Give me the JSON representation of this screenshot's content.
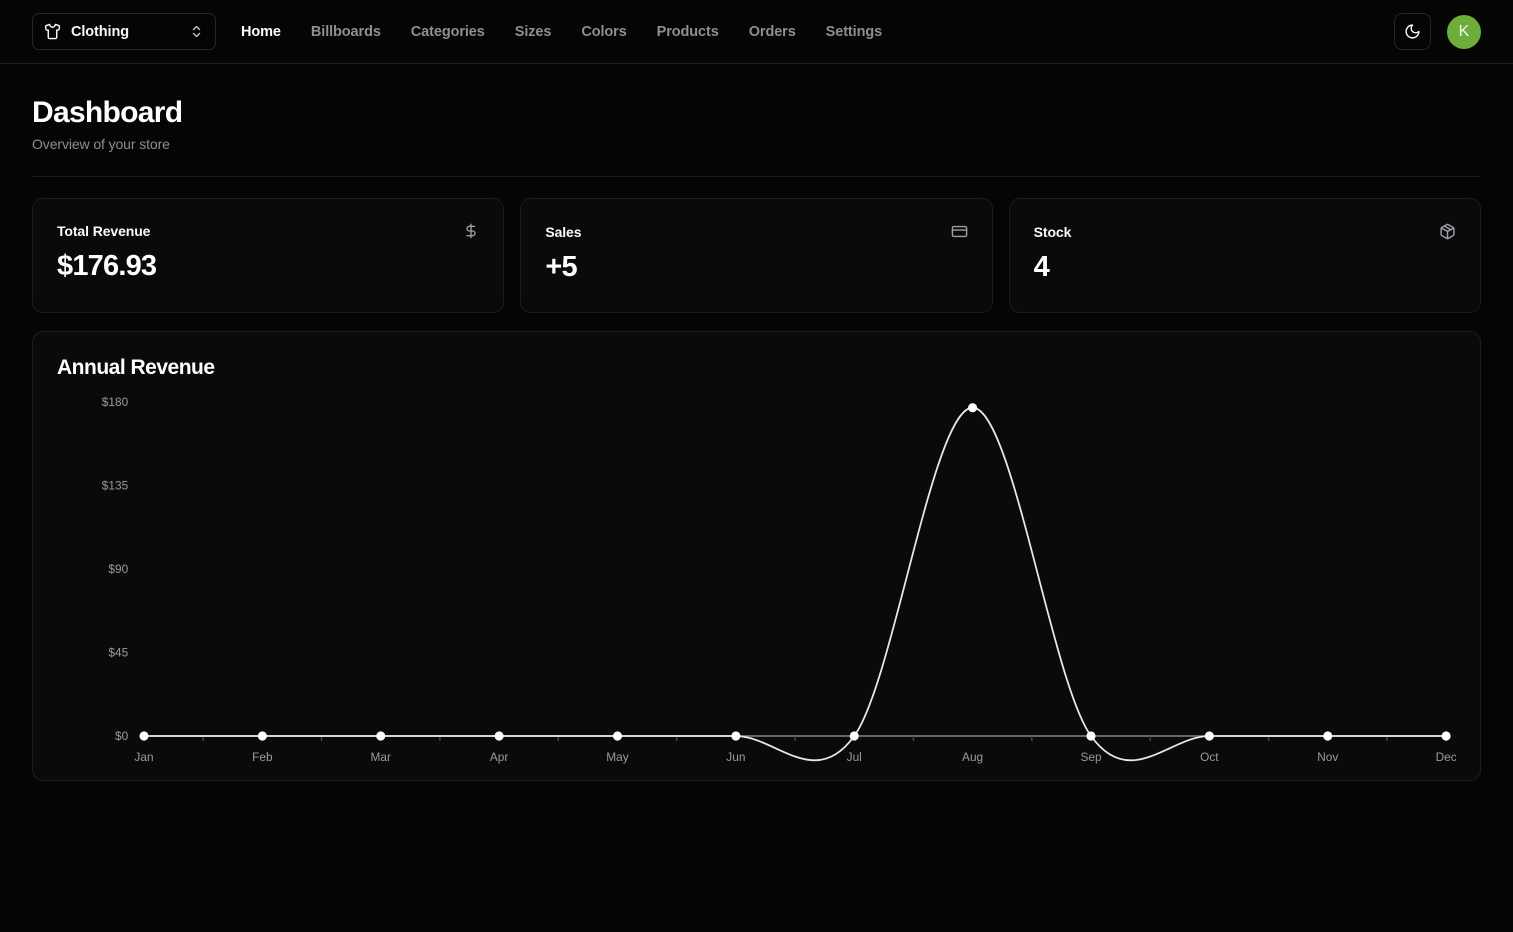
{
  "navbar": {
    "store_switcher": {
      "label": "Clothing",
      "store_icon": "shirt-icon",
      "chevron_icon": "chevrons-up-down-icon"
    },
    "links": [
      {
        "label": "Home",
        "active": true
      },
      {
        "label": "Billboards",
        "active": false
      },
      {
        "label": "Categories",
        "active": false
      },
      {
        "label": "Sizes",
        "active": false
      },
      {
        "label": "Colors",
        "active": false
      },
      {
        "label": "Products",
        "active": false
      },
      {
        "label": "Orders",
        "active": false
      },
      {
        "label": "Settings",
        "active": false
      }
    ],
    "theme_toggle": {
      "icon": "moon-icon"
    },
    "avatar": {
      "initial": "K",
      "color": "#6CAD3C"
    }
  },
  "header": {
    "title": "Dashboard",
    "subtitle": "Overview of your store"
  },
  "stats": [
    {
      "title": "Total Revenue",
      "value": "$176.93",
      "icon": "dollar-sign-icon"
    },
    {
      "title": "Sales",
      "value": "+5",
      "icon": "credit-card-icon"
    },
    {
      "title": "Stock",
      "value": "4",
      "icon": "package-icon"
    }
  ],
  "chart_card": {
    "title": "Annual Revenue"
  },
  "chart_data": {
    "type": "line",
    "title": "Annual Revenue",
    "xlabel": "",
    "ylabel": "",
    "categories": [
      "Jan",
      "Feb",
      "Mar",
      "Apr",
      "May",
      "Jun",
      "Jul",
      "Aug",
      "Sep",
      "Oct",
      "Nov",
      "Dec"
    ],
    "values": [
      0,
      0,
      0,
      0,
      0,
      0,
      0,
      176.93,
      0,
      0,
      0,
      0
    ],
    "series": [
      {
        "name": "Revenue",
        "values": [
          0,
          0,
          0,
          0,
          0,
          0,
          0,
          176.93,
          0,
          0,
          0,
          0
        ]
      }
    ],
    "ytick_labels": [
      "$0",
      "$45",
      "$90",
      "$135",
      "$180"
    ],
    "ytick_values": [
      0,
      45,
      90,
      135,
      180
    ],
    "ylim": [
      0,
      180
    ],
    "grid": false,
    "legend": "none",
    "line_color": "#e8e8ea",
    "point_color": "#ffffff",
    "curve": "smooth"
  },
  "colors": {
    "page_bg": "#050506",
    "card_bg": "#0a0a0b",
    "border": "#1c1c1f",
    "text": "#fafafa",
    "muted": "#8e8e95",
    "accent": "#6CAD3C"
  }
}
